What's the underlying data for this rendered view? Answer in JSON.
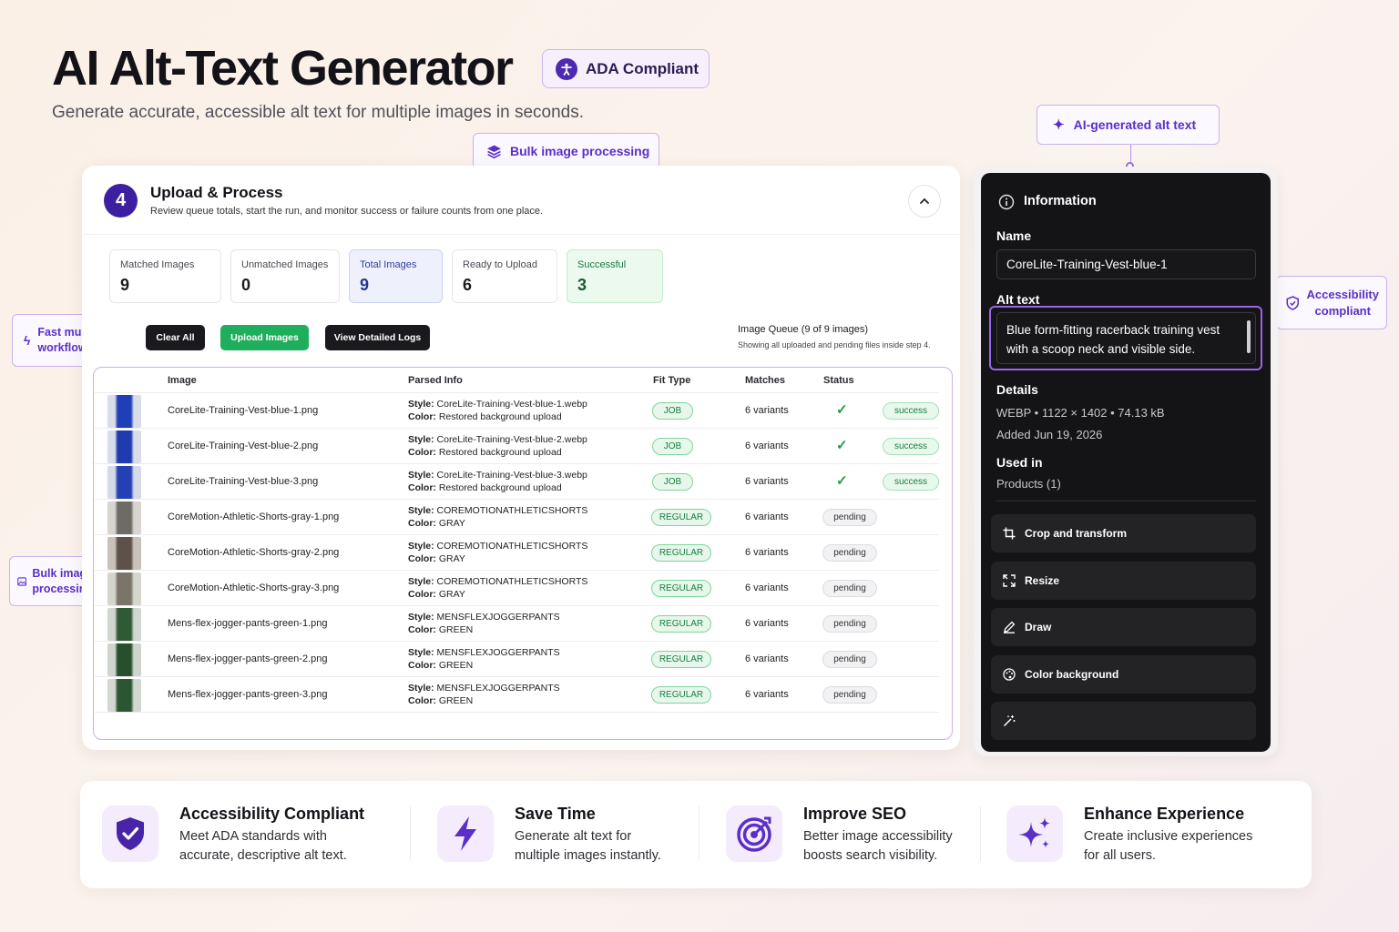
{
  "header": {
    "title": "AI Alt-Text Generator",
    "subtitle": "Generate accurate, accessible alt text for multiple images in seconds.",
    "badge": "ADA Compliant"
  },
  "callouts": {
    "bulk_top": "Bulk image processing",
    "ai_generated": "AI-generated alt text",
    "fast_workflow": "Fast multi-image workflow",
    "bulk_left": "Bulk image processing",
    "accessibility": "Accessibility compliant"
  },
  "step": {
    "number": "4",
    "title": "Upload & Process",
    "description": "Review queue totals, start the run, and monitor success or failure counts from one place."
  },
  "stats": [
    {
      "label": "Matched Images",
      "value": "9"
    },
    {
      "label": "Unmatched Images",
      "value": "0"
    },
    {
      "label": "Total Images",
      "value": "9"
    },
    {
      "label": "Ready to Upload",
      "value": "6"
    },
    {
      "label": "Successful",
      "value": "3"
    }
  ],
  "actions": {
    "clear": "Clear All",
    "upload": "Upload Images",
    "logs": "View Detailed Logs"
  },
  "queue": {
    "title": "Image Queue (9 of 9 images)",
    "subtitle": "Showing all uploaded and pending files inside step 4."
  },
  "table": {
    "headers": [
      "Image",
      "Parsed Info",
      "Fit Type",
      "Matches",
      "Status"
    ],
    "style_key": "Style:",
    "color_key": "Color:",
    "rows": [
      {
        "name": "CoreLite-Training-Vest-blue-1.png",
        "style": "CoreLite-Training-Vest-blue-1.webp",
        "color": "Restored background upload",
        "fit": "JOB",
        "matches": "6 variants",
        "status": "success"
      },
      {
        "name": "CoreLite-Training-Vest-blue-2.png",
        "style": "CoreLite-Training-Vest-blue-2.webp",
        "color": "Restored background upload",
        "fit": "JOB",
        "matches": "6 variants",
        "status": "success"
      },
      {
        "name": "CoreLite-Training-Vest-blue-3.png",
        "style": "CoreLite-Training-Vest-blue-3.webp",
        "color": "Restored background upload",
        "fit": "JOB",
        "matches": "6 variants",
        "status": "success"
      },
      {
        "name": "CoreMotion-Athletic-Shorts-gray-1.png",
        "style": "COREMOTIONATHLETICSHORTS",
        "color": "GRAY",
        "fit": "REGULAR",
        "matches": "6 variants",
        "status": "pending"
      },
      {
        "name": "CoreMotion-Athletic-Shorts-gray-2.png",
        "style": "COREMOTIONATHLETICSHORTS",
        "color": "GRAY",
        "fit": "REGULAR",
        "matches": "6 variants",
        "status": "pending"
      },
      {
        "name": "CoreMotion-Athletic-Shorts-gray-3.png",
        "style": "COREMOTIONATHLETICSHORTS",
        "color": "GRAY",
        "fit": "REGULAR",
        "matches": "6 variants",
        "status": "pending"
      },
      {
        "name": "Mens-flex-jogger-pants-green-1.png",
        "style": "MENSFLEXJOGGERPANTS",
        "color": "GREEN",
        "fit": "REGULAR",
        "matches": "6 variants",
        "status": "pending"
      },
      {
        "name": "Mens-flex-jogger-pants-green-2.png",
        "style": "MENSFLEXJOGGERPANTS",
        "color": "GREEN",
        "fit": "REGULAR",
        "matches": "6 variants",
        "status": "pending"
      },
      {
        "name": "Mens-flex-jogger-pants-green-3.png",
        "style": "MENSFLEXJOGGERPANTS",
        "color": "GREEN",
        "fit": "REGULAR",
        "matches": "6 variants",
        "status": "pending"
      }
    ]
  },
  "panel": {
    "heading": "Information",
    "name_label": "Name",
    "name_value": "CoreLite-Training-Vest-blue-1",
    "alt_label": "Alt text",
    "alt_value": "Blue form-fitting racerback training vest with a scoop neck and visible side.",
    "details_label": "Details",
    "details_value": "WEBP • 1122 × 1402 • 74.13 kB",
    "added": "Added Jun 19, 2026",
    "used_label": "Used in",
    "used_value": "Products (1)",
    "tools": [
      "Crop and transform",
      "Resize",
      "Draw",
      "Color background",
      ""
    ]
  },
  "features": [
    {
      "title": "Accessibility Compliant",
      "line1": "Meet ADA standards with",
      "line2": "accurate, descriptive alt text.",
      "icon": "shield-check-icon"
    },
    {
      "title": "Save Time",
      "line1": "Generate alt text for",
      "line2": "multiple images instantly.",
      "icon": "lightning-icon"
    },
    {
      "title": "Improve SEO",
      "line1": "Better image accessibility",
      "line2": "boosts search visibility.",
      "icon": "target-icon"
    },
    {
      "title": "Enhance Experience",
      "line1": "Create inclusive experiences",
      "line2": "for all users.",
      "icon": "sparkles-icon"
    }
  ],
  "colors": {
    "accent": "#4c2bb0",
    "callout_text": "#5a2fc8",
    "success": "#17803e",
    "upload_button": "#1fae5b",
    "dark_panel": "#141416"
  }
}
